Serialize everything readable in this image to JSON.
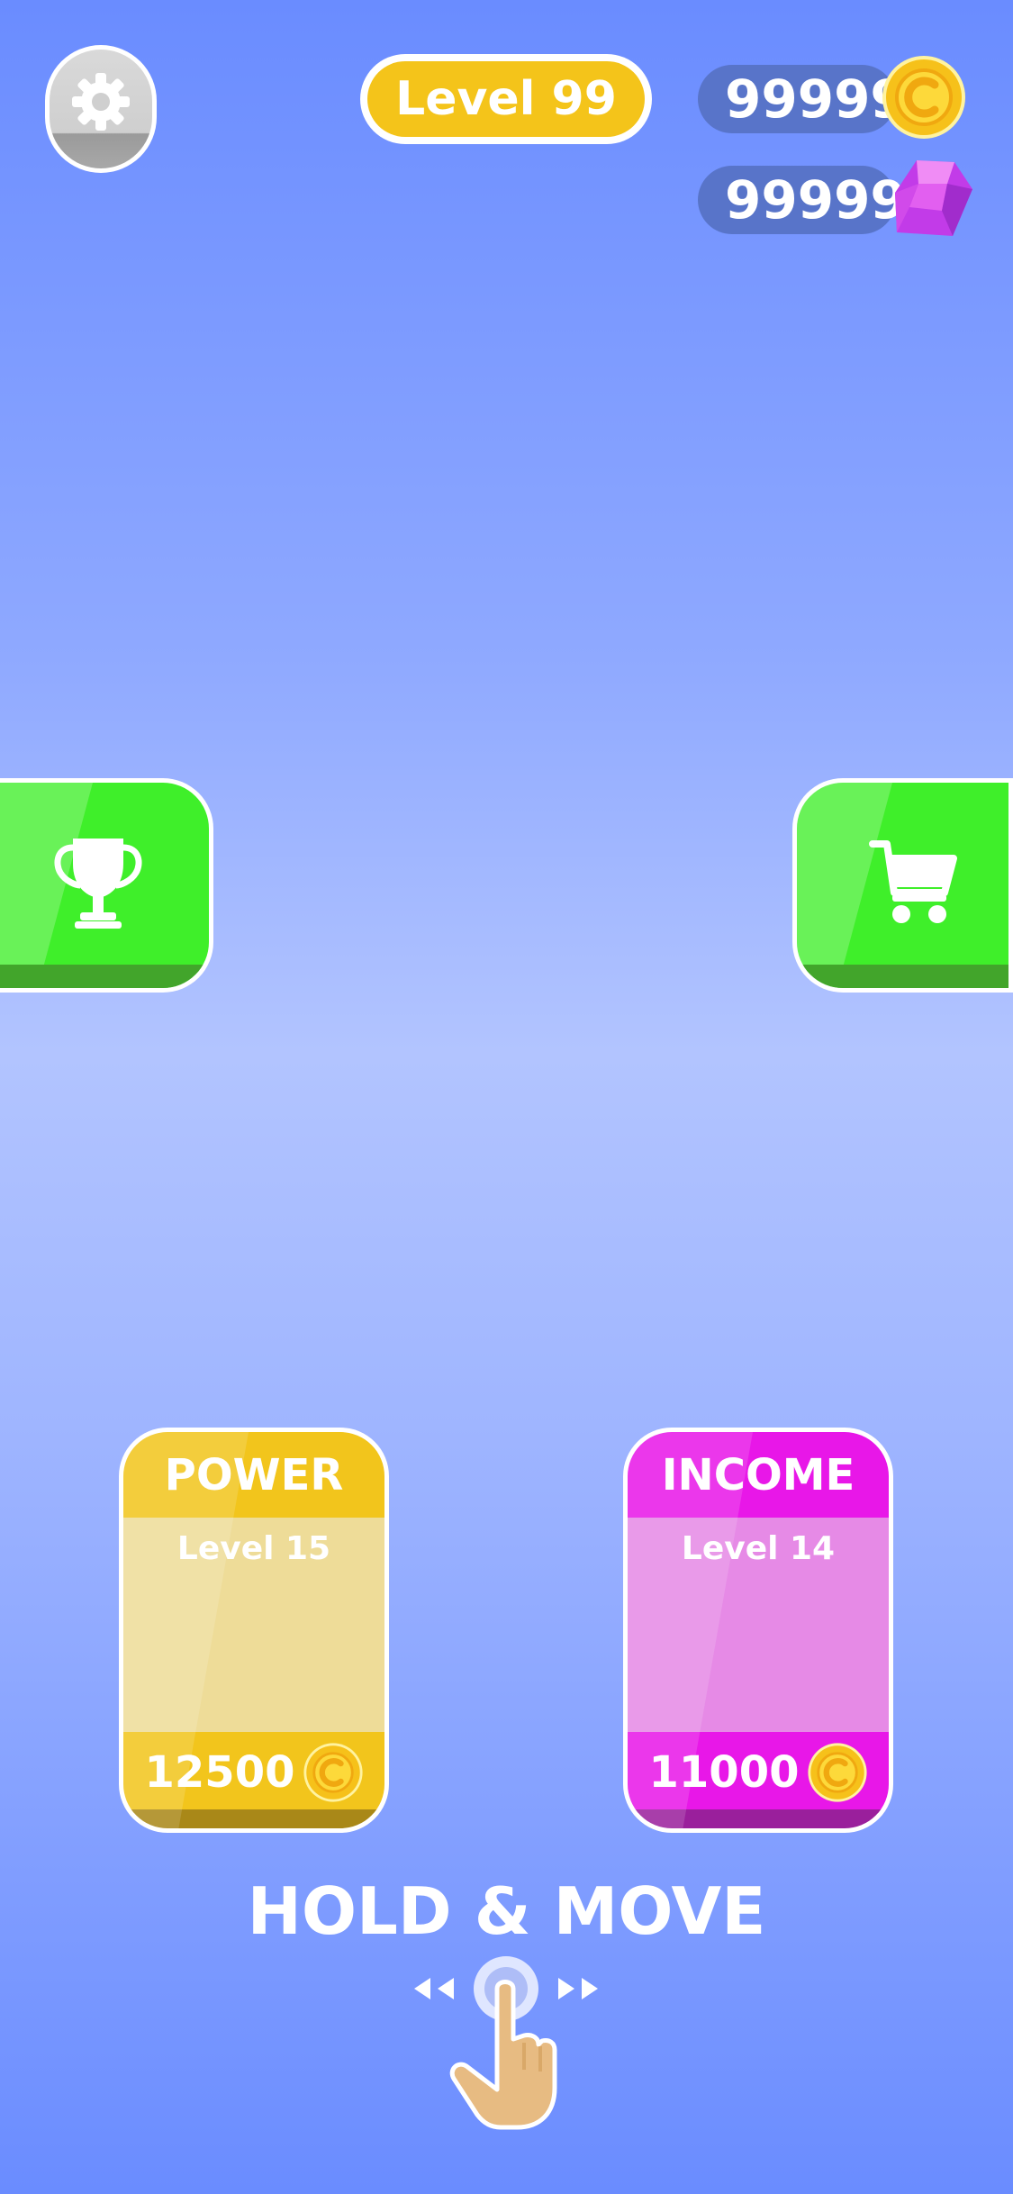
{
  "hud": {
    "level_label": "Level 99",
    "coins": "99999",
    "gems": "99999"
  },
  "upgrades": [
    {
      "title": "POWER",
      "level": "Level 15",
      "cost": "12500",
      "color": "#f2c51c"
    },
    {
      "title": "INCOME",
      "level": "Level 14",
      "cost": "11000",
      "color": "#e817e8"
    }
  ],
  "hint": {
    "text": "HOLD & MOVE"
  },
  "icons": {
    "settings": "gear-icon",
    "leaderboard": "trophy-icon",
    "shop": "cart-icon",
    "coin": "coin-icon",
    "gem": "gem-icon",
    "gesture": "hand-drag-icon"
  },
  "colors": {
    "background": "#8fa9ff",
    "accent_green": "#3fef2a",
    "coin_yellow": "#f4c41a",
    "gem_purple": "#c23be8"
  }
}
